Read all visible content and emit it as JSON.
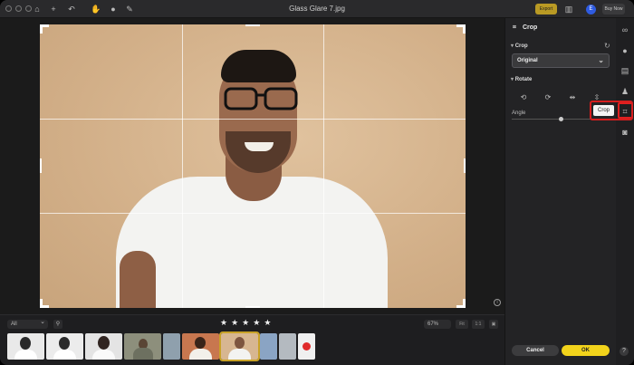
{
  "window": {
    "title": "Glass Glare 7.jpg",
    "export_label": "Export",
    "avatar_label": "E",
    "buy_label": "Buy Now"
  },
  "titlebar_icons": [
    "home-icon",
    "add-icon",
    "undo-icon",
    "hand-icon",
    "mask-icon",
    "brush-icon"
  ],
  "panel": {
    "title": "Crop",
    "crop_section": "Crop",
    "crop_value": "Original",
    "rotate_section": "Rotate",
    "angle_label": "Angle",
    "cancel_label": "Cancel",
    "ok_label": "OK",
    "angle_value": 0.5
  },
  "tooltip": {
    "text": "Crop"
  },
  "filmstrip": {
    "filter_value": "All",
    "zoom_value": "67%",
    "fit_label": "Fit",
    "one_to_one_label": "1:1",
    "rating_stars": 5
  },
  "colors": {
    "accent": "#f2d31b",
    "export": "#b99a24",
    "highlight": "#e02020",
    "photo_background": "#d7b691"
  }
}
